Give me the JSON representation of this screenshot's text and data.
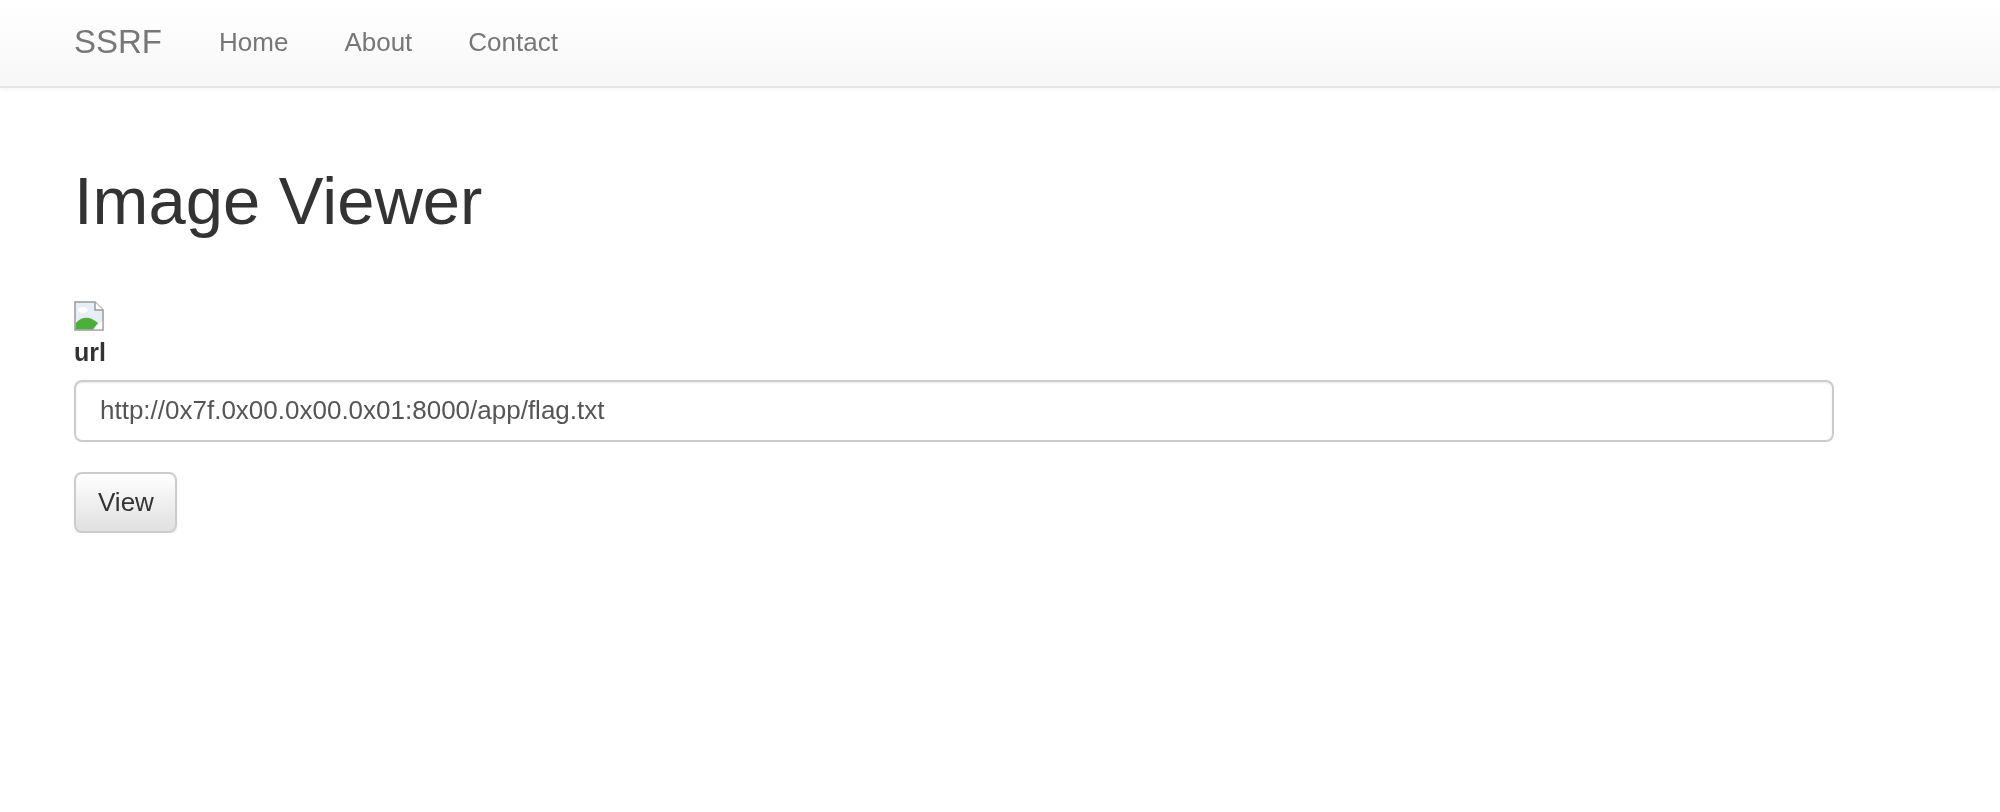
{
  "navbar": {
    "brand": "SSRF",
    "links": [
      {
        "label": "Home"
      },
      {
        "label": "About"
      },
      {
        "label": "Contact"
      }
    ]
  },
  "page": {
    "title": "Image Viewer"
  },
  "form": {
    "label": "url",
    "field": {
      "value": "http://0x7f.0x00.0x00.0x01:8000/app/flag.txt"
    },
    "button": "View"
  }
}
